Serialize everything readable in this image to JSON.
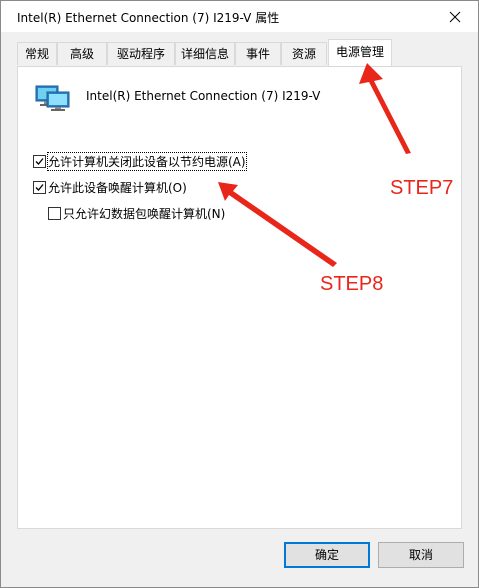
{
  "window": {
    "title": "Intel(R) Ethernet Connection (7) I219-V 属性"
  },
  "tabs": [
    {
      "label": "常规"
    },
    {
      "label": "高级"
    },
    {
      "label": "驱动程序"
    },
    {
      "label": "详细信息"
    },
    {
      "label": "事件"
    },
    {
      "label": "资源"
    },
    {
      "label": "电源管理"
    }
  ],
  "active_tab": "电源管理",
  "device": {
    "name": "Intel(R) Ethernet Connection (7) I219-V",
    "icon": "network-adapter-icon"
  },
  "options": {
    "allow_turn_off": {
      "label": "允许计算机关闭此设备以节约电源(A)",
      "checked": true
    },
    "allow_wake": {
      "label": "允许此设备唤醒计算机(O)",
      "checked": true
    },
    "only_magic_packet": {
      "label": "只允许幻数据包唤醒计算机(N)",
      "checked": false
    }
  },
  "buttons": {
    "ok": "确定",
    "cancel": "取消"
  },
  "annotations": {
    "step7": "STEP7",
    "step8": "STEP8",
    "color": "#e8261a"
  }
}
